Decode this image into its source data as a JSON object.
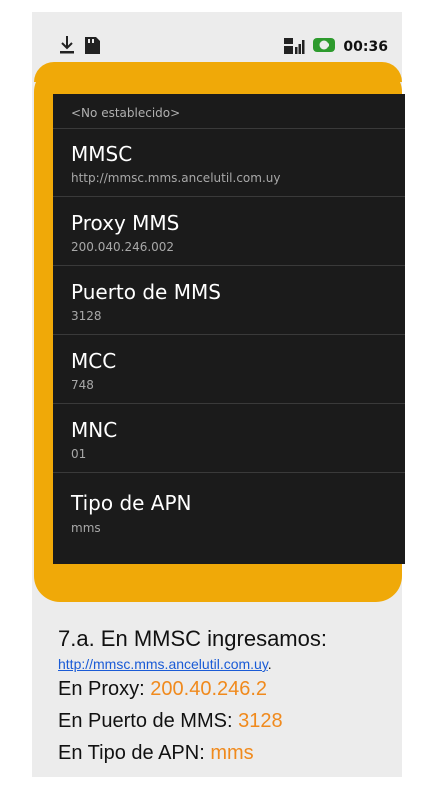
{
  "status_bar": {
    "time": "00:36",
    "left_icons": [
      "download-icon",
      "sd-card-icon"
    ],
    "right_icons": [
      "signal-icon",
      "battery-icon"
    ]
  },
  "apn_settings": {
    "partial_top_value": "<No establecido>",
    "items": [
      {
        "title": "MMSC",
        "value": "http://mmsc.mms.ancelutil.com.uy"
      },
      {
        "title": "Proxy MMS",
        "value": "200.040.246.002"
      },
      {
        "title": "Puerto de MMS",
        "value": "3128"
      },
      {
        "title": "MCC",
        "value": "748"
      },
      {
        "title": "MNC",
        "value": "01"
      },
      {
        "title": "Tipo de APN",
        "value": "mms"
      }
    ]
  },
  "caption": {
    "line1": "7.a. En MMSC ingresamos:",
    "link": "http://mmsc.mms.ancelutil.com.uy",
    "link_suffix": ".",
    "proxy_label": "En Proxy: ",
    "proxy_value": "200.40.246.2",
    "port_label": "En Puerto de MMS: ",
    "port_value": "3128",
    "apn_label": "En Tipo de APN: ",
    "apn_value": "mms"
  },
  "colors": {
    "highlight_frame": "#f0a908",
    "accent_text": "#f08a1d",
    "link": "#1a5bd6",
    "screen_bg": "#1b1b1b"
  }
}
